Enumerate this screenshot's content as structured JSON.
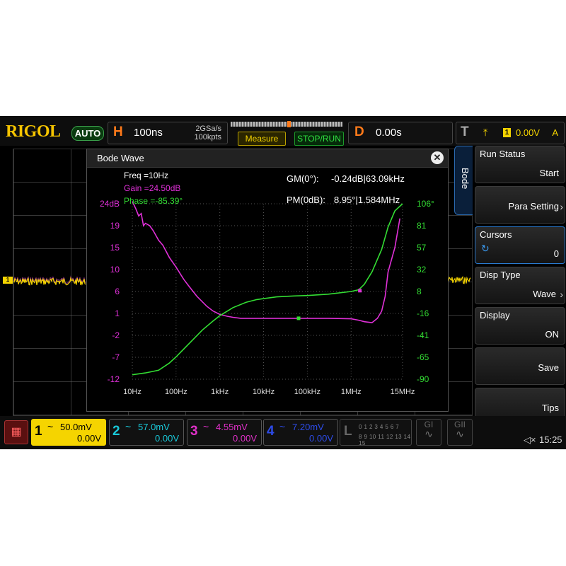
{
  "brand": "RIGOL",
  "run_mode": "AUTO",
  "horizontal": {
    "letter": "H",
    "timebase": "100ns",
    "sample_rate": "2GSa/s",
    "memory": "100kpts"
  },
  "buttons": {
    "measure": "Measure",
    "stop_run": "STOP/RUN"
  },
  "delay": {
    "letter": "D",
    "value": "0.00s"
  },
  "trigger": {
    "letter": "T",
    "edge_symbol": "⤒",
    "channel": "1",
    "level": "0.00V",
    "mode": "A"
  },
  "ch1_marker": "1",
  "menu": {
    "tab": "Bode",
    "items": [
      {
        "title": "Run Status",
        "value": "Start"
      },
      {
        "title": "",
        "value": "Para Setting"
      },
      {
        "title": "Cursors",
        "value": "0"
      },
      {
        "title": "Disp Type",
        "value": "Wave"
      },
      {
        "title": "Display",
        "value": "ON"
      },
      {
        "title": "",
        "value": "Save"
      },
      {
        "title": "",
        "value": "Tips"
      }
    ]
  },
  "bode": {
    "title": "Bode Wave",
    "close_symbol": "✕",
    "freq": "Freq =10Hz",
    "gain": "Gain =24.50dB",
    "phase": "Phase =-85.39°",
    "gm_label": "GM(0°):",
    "gm_value": "-0.24dB|63.09kHz",
    "pm_label": "PM(0dB):",
    "pm_value": "8.95°|1.584MHz"
  },
  "channels": [
    {
      "num": "1",
      "symbol": "~",
      "scale": "50.0mV",
      "offset": "0.00V",
      "color": "#f5d400"
    },
    {
      "num": "2",
      "symbol": "~",
      "scale": "57.0mV",
      "offset": "0.00V",
      "color": "#19c8d8"
    },
    {
      "num": "3",
      "symbol": "~",
      "scale": "4.55mV",
      "offset": "0.00V",
      "color": "#e030c8"
    },
    {
      "num": "4",
      "symbol": "~",
      "scale": "7.20mV",
      "offset": "0.00V",
      "color": "#2d4be8"
    }
  ],
  "logic": {
    "letter": "L",
    "row1": "0 1 2 3 4 5 6 7",
    "row2": "8 9 10 11 12 13 14 15"
  },
  "gbuttons": [
    "GI",
    "GII"
  ],
  "status": {
    "speaker": "◁×",
    "time": "15:25"
  },
  "chart_data": {
    "type": "line",
    "x_scale": "log",
    "x_ticks": [
      "10Hz",
      "100Hz",
      "1kHz",
      "10kHz",
      "100kHz",
      "1MHz",
      "15MHz"
    ],
    "xlim": [
      10,
      15000000
    ],
    "gain_ticks": [
      "24dB",
      "19",
      "15",
      "10",
      "6",
      "1",
      "-2",
      "-7",
      "-12"
    ],
    "gain_lim": [
      -12,
      24
    ],
    "phase_ticks": [
      "106°",
      "81",
      "57",
      "32",
      "8",
      "-16",
      "-41",
      "-65",
      "-90"
    ],
    "phase_lim": [
      -90,
      106
    ],
    "grid": true,
    "series": [
      {
        "name": "Gain",
        "axis": "left",
        "color": "#e030d8",
        "x": [
          10,
          12,
          14,
          16,
          18,
          20,
          25,
          30,
          40,
          50,
          70,
          100,
          150,
          200,
          300,
          500,
          700,
          1000,
          1500,
          2000,
          3000,
          5000,
          10000,
          30000,
          100000,
          300000,
          1000000,
          1500000,
          2000000,
          3000000,
          4000000,
          5000000,
          6000000,
          7000000,
          10000000,
          13000000
        ],
        "y": [
          24.5,
          23,
          21.5,
          22,
          19.5,
          20,
          19.5,
          18.5,
          16.5,
          15.5,
          13,
          11,
          8.5,
          7,
          5,
          3,
          2,
          1.3,
          0.9,
          0.7,
          0.5,
          0.5,
          0.5,
          0.5,
          0.5,
          0.5,
          0.4,
          0.1,
          -0.2,
          -0.4,
          0.5,
          2,
          5,
          10,
          15,
          21
        ]
      },
      {
        "name": "Phase",
        "axis": "right",
        "color": "#33dd33",
        "x": [
          10,
          20,
          40,
          70,
          100,
          200,
          400,
          700,
          1000,
          2000,
          4000,
          7000,
          10000,
          20000,
          50000,
          100000,
          300000,
          1000000,
          1500000,
          2000000,
          3000000,
          5000000,
          7000000,
          10000000,
          15000000
        ],
        "y": [
          -85,
          -83,
          -80,
          -72,
          -65,
          -50,
          -35,
          -25,
          -19,
          -10,
          -4,
          -1,
          0,
          2,
          3,
          3.5,
          5,
          8,
          10,
          16,
          30,
          55,
          80,
          98,
          106
        ]
      }
    ],
    "markers": [
      {
        "series": "Gain",
        "x": 63090,
        "y": 0.5
      },
      {
        "series": "Phase",
        "x": 1584000,
        "y": 8.95
      }
    ]
  }
}
